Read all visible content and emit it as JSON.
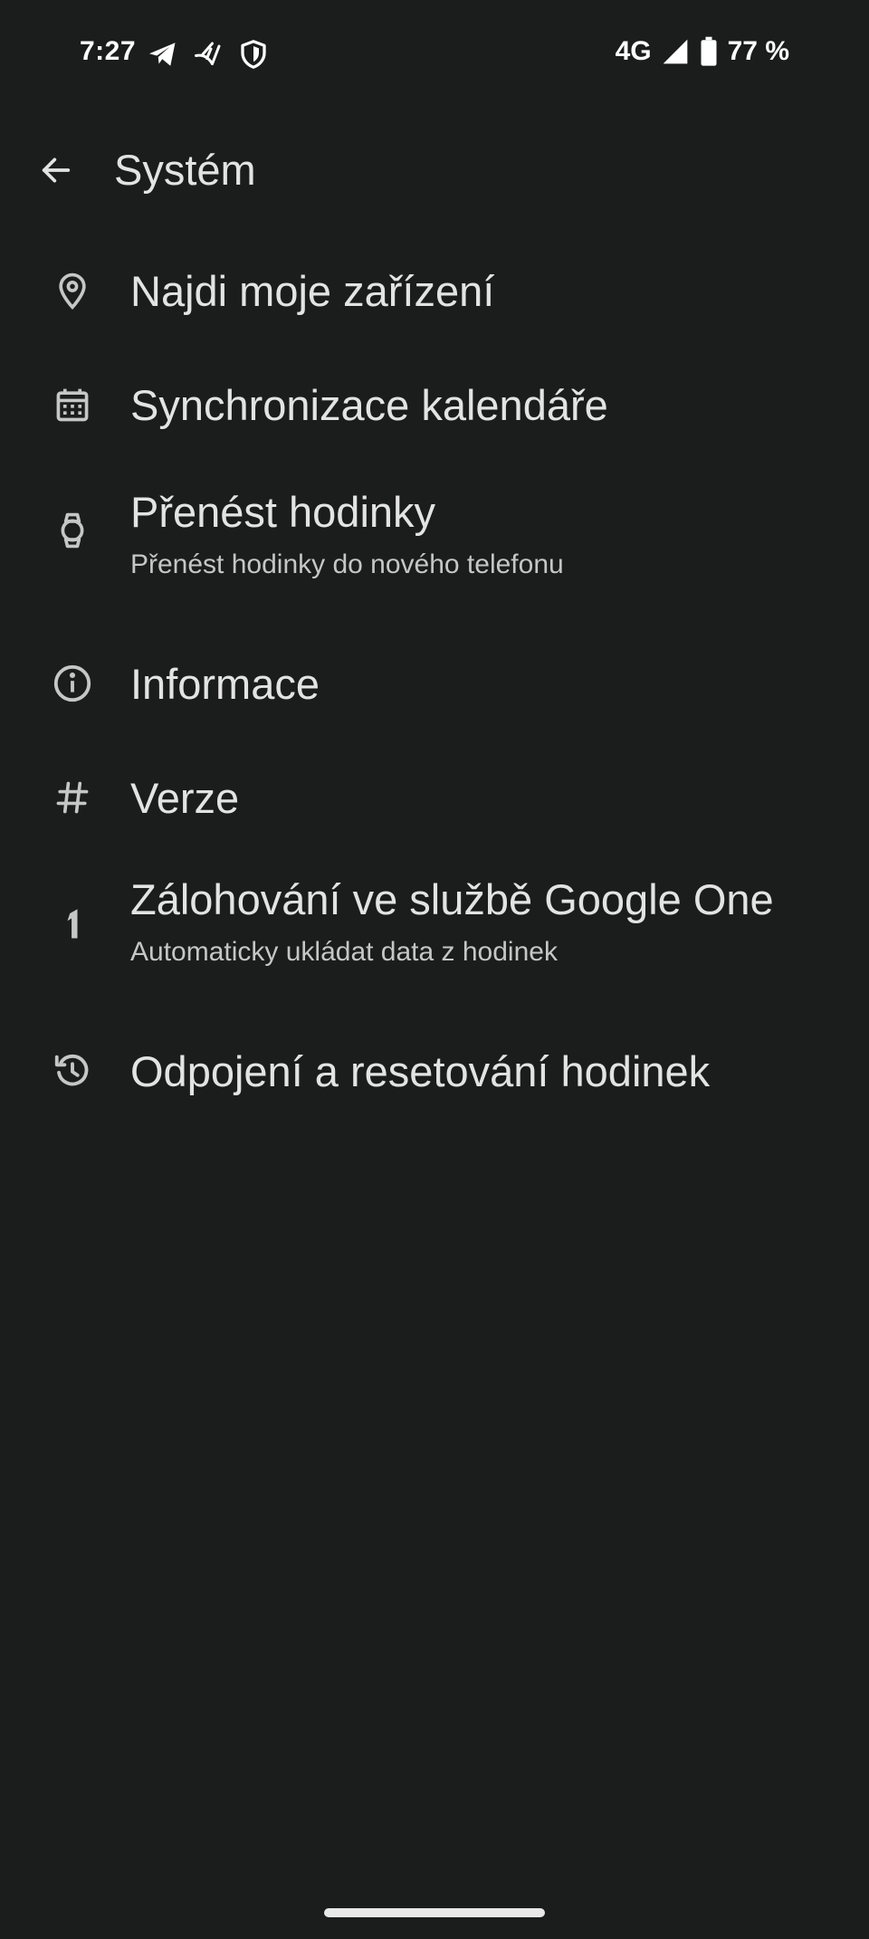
{
  "status_bar": {
    "time": "7:27",
    "network": "4G",
    "battery": "77 %",
    "icons": [
      "telegram-icon",
      "bird-icon",
      "shield-icon",
      "signal-icon",
      "battery-icon"
    ]
  },
  "header": {
    "title": "Systém",
    "back_icon": "arrow-back-icon"
  },
  "items": [
    {
      "id": "find-device",
      "icon": "location-pin-icon",
      "title": "Najdi moje zařízení",
      "subtitle": ""
    },
    {
      "id": "calendar-sync",
      "icon": "calendar-icon",
      "title": "Synchronizace kalendáře",
      "subtitle": ""
    },
    {
      "id": "transfer-watch",
      "icon": "watch-icon",
      "title": "Přenést hodinky",
      "subtitle": "Přenést hodinky do nového telefonu"
    },
    {
      "id": "about",
      "icon": "info-icon",
      "title": "Informace",
      "subtitle": ""
    },
    {
      "id": "version",
      "icon": "hash-icon",
      "title": "Verze",
      "subtitle": ""
    },
    {
      "id": "google-one-backup",
      "icon": "google-one-icon",
      "title": "Zálohování ve službě Google One",
      "subtitle": "Automaticky ukládat data z hodinek"
    },
    {
      "id": "disconnect-reset",
      "icon": "history-icon",
      "title": "Odpojení a resetování hodinek",
      "subtitle": ""
    }
  ],
  "colors": {
    "background": "#1b1c1c",
    "text_primary": "#e3e3e3",
    "text_secondary": "#c4c7c5",
    "icon": "#c4c7c5"
  }
}
